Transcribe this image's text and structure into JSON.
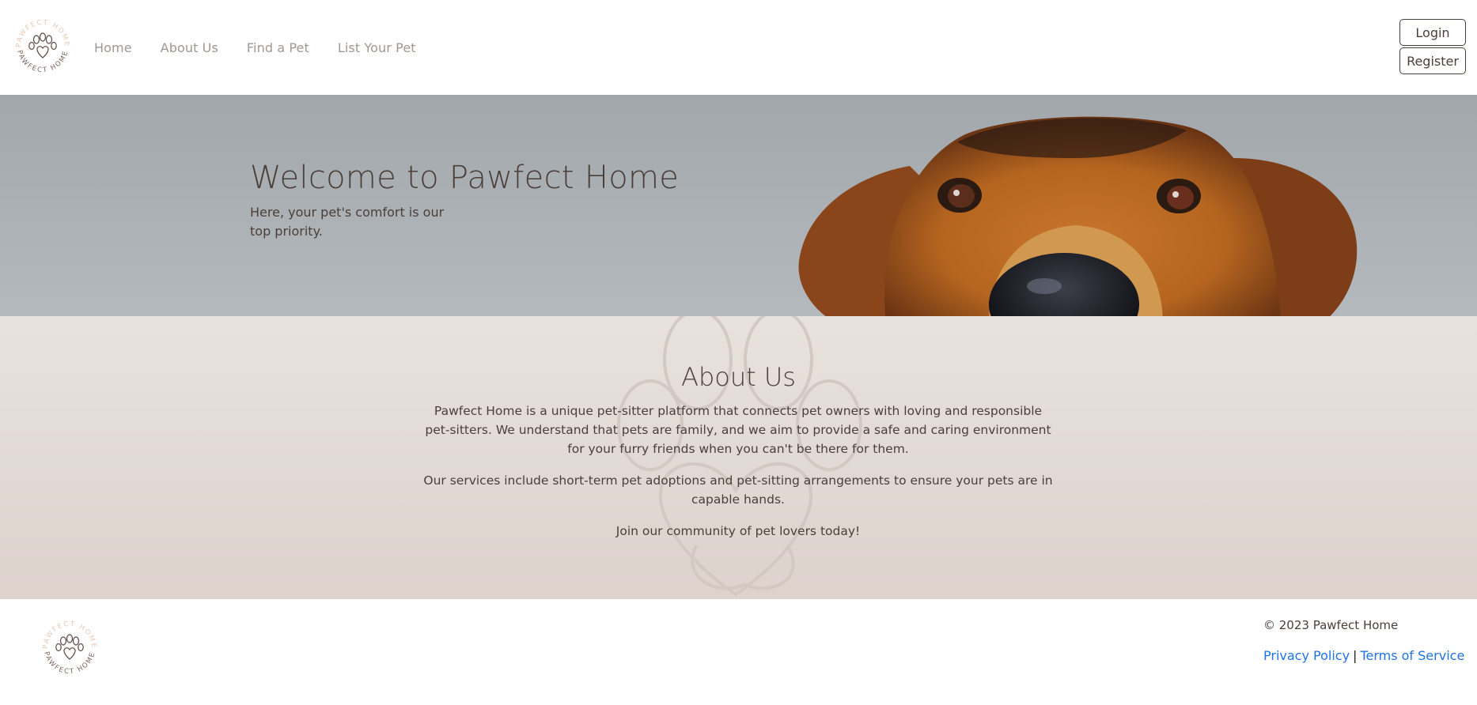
{
  "header": {
    "logo_text": "PAWFECT HOME",
    "nav": [
      {
        "label": "Home"
      },
      {
        "label": "About Us"
      },
      {
        "label": "Find a Pet"
      },
      {
        "label": "List Your Pet"
      }
    ],
    "login_label": "Login",
    "register_label": "Register"
  },
  "hero": {
    "title": "Welcome to Pawfect Home",
    "subtitle": "Here, your pet's comfort is our top priority."
  },
  "about": {
    "title": "About Us",
    "paragraphs": [
      "Pawfect Home is a unique pet-sitter platform that connects pet owners with loving and responsible pet-sitters. We understand that pets are family, and we aim to provide a safe and caring environment for your furry friends when you can't be there for them.",
      "Our services include short-term pet adoptions and pet-sitting arrangements to ensure your pets are in capable hands.",
      "Join our community of pet lovers today!"
    ]
  },
  "footer": {
    "logo_text": "PAWFECT HOME",
    "copyright": "© 2023 Pawfect Home",
    "privacy_label": "Privacy Policy",
    "separator": "|",
    "terms_label": "Terms of Service"
  },
  "colors": {
    "text": "#4a3f39",
    "nav": "#a09891",
    "link": "#1f73e6",
    "hero_bg": "#a9aeb2",
    "about_bg": "#e3dbd6"
  },
  "icons": [
    "paw-heart-logo",
    "paw-watermark-icon",
    "dog-face-image"
  ]
}
